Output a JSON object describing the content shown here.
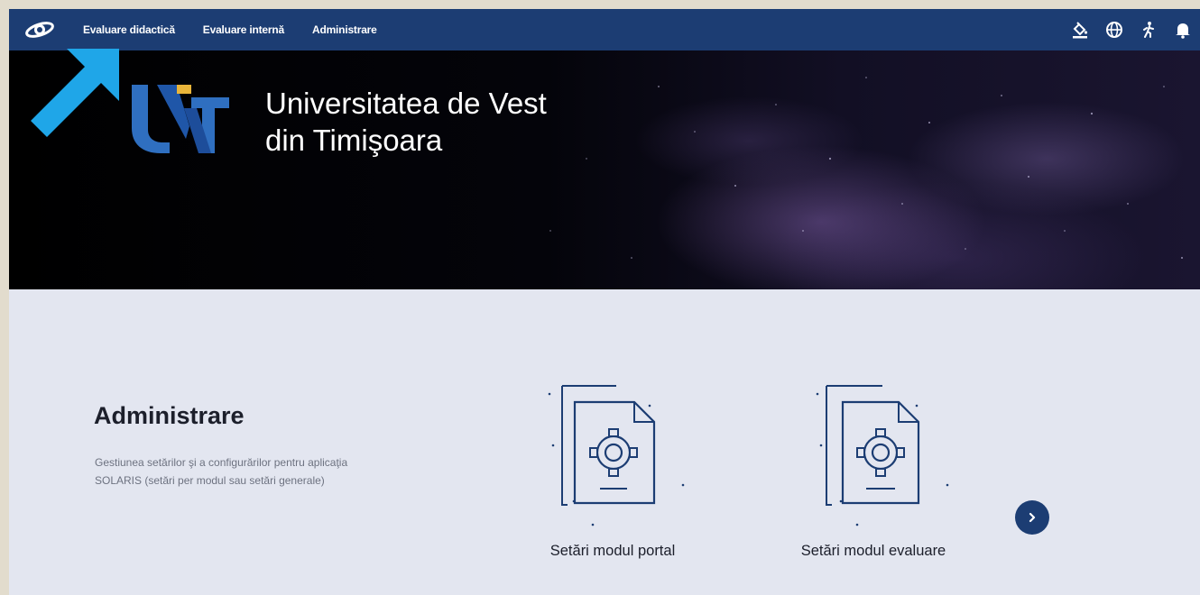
{
  "nav": {
    "items": [
      {
        "label": "Evaluare didactică"
      },
      {
        "label": "Evaluare internă"
      },
      {
        "label": "Administrare"
      }
    ],
    "right_icons": [
      "paint-bucket-icon",
      "globe-icon",
      "accessibility-icon",
      "bell-icon"
    ]
  },
  "hero": {
    "university_line1": "Universitatea de Vest",
    "university_line2": "din Timişoara"
  },
  "section": {
    "title": "Administrare",
    "description": "Gestiunea setărilor şi a configurărilor pentru aplicaţia SOLARIS (setări per modul sau setări generale)"
  },
  "cards": [
    {
      "label": "Setări modul portal",
      "icon": "document-gear-icon"
    },
    {
      "label": "Setări modul evaluare",
      "icon": "document-gear-icon"
    }
  ],
  "colors": {
    "nav_bg": "#1c3d73",
    "accent_blue": "#1fa6e8",
    "logo_gold": "#e9b53a"
  }
}
